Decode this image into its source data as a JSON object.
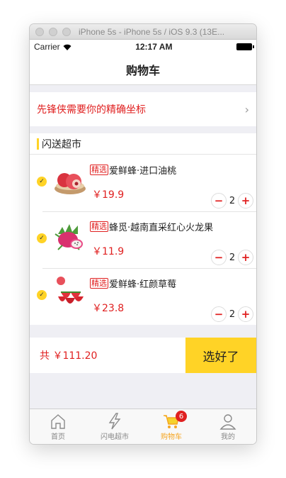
{
  "window": {
    "title": "iPhone 5s - iPhone 5s / iOS 9.3 (13E..."
  },
  "status": {
    "carrier": "Carrier",
    "time": "12:17 AM"
  },
  "nav": {
    "title": "购物车"
  },
  "location": {
    "text": "先锋侠需要你的精确坐标"
  },
  "section": {
    "title": "闪送超市"
  },
  "items": [
    {
      "badge": "精选",
      "name": "爱鲜蜂·进口油桃",
      "price": "￥19.9",
      "qty": "2"
    },
    {
      "badge": "精选",
      "name": "蜂觅·越南直采红心火龙果",
      "price": "￥11.9",
      "qty": "2"
    },
    {
      "badge": "精选",
      "name": "爱鲜蜂·红颜草莓",
      "price": "￥23.8",
      "qty": "2"
    }
  ],
  "footer": {
    "total": "共 ￥111.20",
    "submit": "选好了"
  },
  "tabs": [
    {
      "label": "首页",
      "icon": "home-icon"
    },
    {
      "label": "闪电超市",
      "icon": "lightning-icon"
    },
    {
      "label": "购物车",
      "icon": "cart-icon",
      "badge": "6"
    },
    {
      "label": "我的",
      "icon": "profile-icon"
    }
  ],
  "colors": {
    "accent": "#ffd326",
    "price": "#e02020",
    "active_tab": "#f5a623"
  }
}
